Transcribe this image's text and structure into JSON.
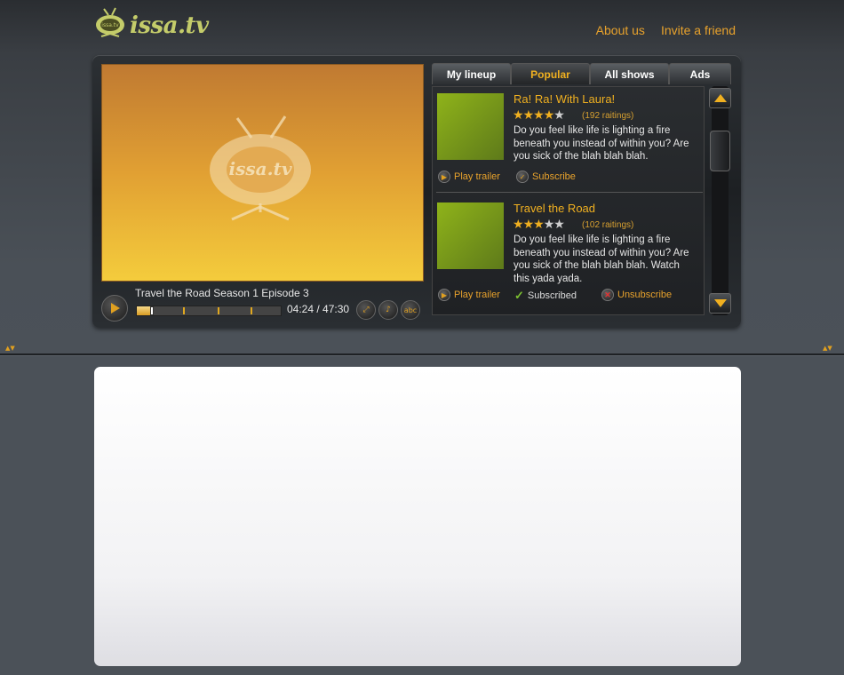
{
  "header": {
    "logo_text": "issa.tv",
    "logo_badge": "issa.tv",
    "links": [
      "About us",
      "Invite a friend"
    ]
  },
  "player": {
    "screen_logo": "issa.tv",
    "episode_title": "Travel the Road Season 1 Episode 3",
    "time_display": "04:24 / 47:30",
    "progress_fraction": 0.093,
    "chapter_marks": [
      0.32,
      0.56,
      0.79
    ],
    "buttons": {
      "play": "play-icon",
      "fullscreen": "fullscreen-icon",
      "volume": "volume-icon",
      "captions": "abc"
    }
  },
  "tabs": [
    {
      "label": "My lineup",
      "active": false
    },
    {
      "label": "Popular",
      "active": true
    },
    {
      "label": "All shows",
      "active": false
    },
    {
      "label": "Ads",
      "active": false
    }
  ],
  "shows": [
    {
      "title": "Ra! Ra! With Laura!",
      "rating": 4,
      "ratings_count": "(192 raitings)",
      "description": "Do you feel like life is lighting a fire beneath you instead of within you? Are you sick of the blah blah blah.",
      "play_trailer": "Play trailer",
      "subscribe": "Subscribe"
    },
    {
      "title": "Travel the Road",
      "rating": 3,
      "ratings_count": "(102 raitings)",
      "description": "Do you feel like life is lighting a fire beneath you instead of within you? Are you sick of the blah blah blah. Watch this yada yada.",
      "play_trailer": "Play trailer",
      "subscribed": "Subscribed",
      "unsubscribe": "Unsubscribe"
    }
  ],
  "colors": {
    "accent": "#f0b020",
    "link": "#e8a22c",
    "thumb": "#7a9a1a"
  }
}
